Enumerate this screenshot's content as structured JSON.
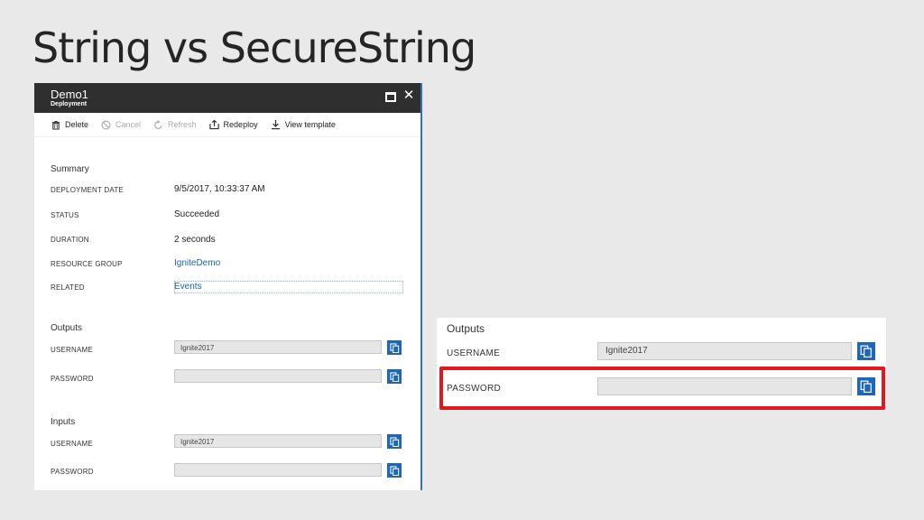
{
  "slide": {
    "title": "String vs SecureString"
  },
  "blade": {
    "title": "Demo1",
    "subtitle": "Deployment",
    "toolbar": {
      "delete": "Delete",
      "cancel": "Cancel",
      "refresh": "Refresh",
      "redeploy": "Redeploy",
      "view_template": "View template"
    },
    "summary": {
      "title": "Summary",
      "rows": [
        {
          "label": "DEPLOYMENT DATE",
          "value": "9/5/2017, 10:33:37 AM"
        },
        {
          "label": "STATUS",
          "value": "Succeeded"
        },
        {
          "label": "DURATION",
          "value": "2 seconds"
        },
        {
          "label": "RESOURCE GROUP",
          "value": "IgniteDemo"
        },
        {
          "label": "RELATED",
          "value": "Events"
        }
      ]
    },
    "outputs": {
      "title": "Outputs",
      "username_label": "USERNAME",
      "username_value": "Ignite2017",
      "password_label": "PASSWORD",
      "password_value": ""
    },
    "inputs": {
      "title": "Inputs",
      "username_label": "USERNAME",
      "username_value": "Ignite2017",
      "password_label": "PASSWORD",
      "password_value": ""
    }
  },
  "zoom": {
    "title": "Outputs",
    "username_label": "USERNAME",
    "username_value": "Ignite2017",
    "password_label": "PASSWORD",
    "password_value": ""
  },
  "colors": {
    "accent": "#1f66b6",
    "highlight": "#e0191e",
    "header": "#2f2f2f",
    "link": "#1666b0"
  }
}
